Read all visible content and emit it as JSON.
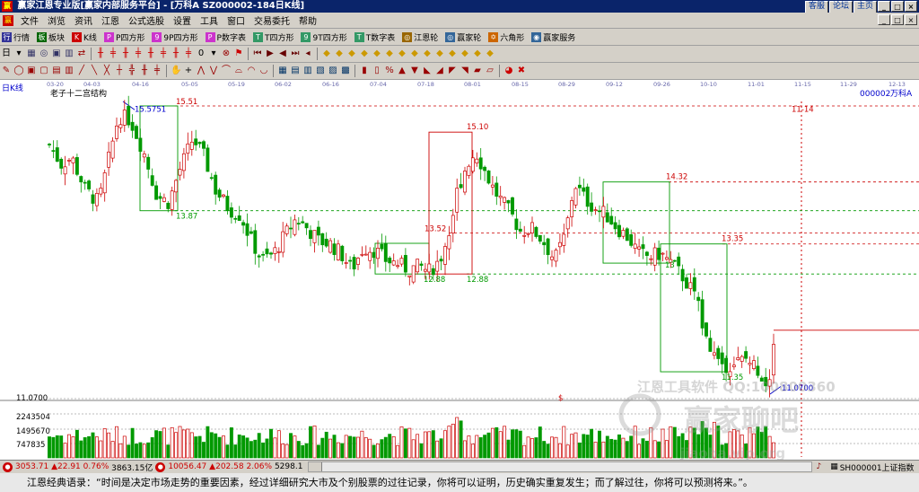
{
  "window": {
    "title": "赢家江恩专业版[赢家内部服务平台] - [万科A  SZ000002-184日K线]",
    "logo_text": "赢",
    "links": [
      "客服",
      "论坛",
      "主页"
    ],
    "controls": [
      "_",
      "□",
      "×"
    ]
  },
  "menu": {
    "items": [
      "文件",
      "浏览",
      "资讯",
      "江恩",
      "公式选股",
      "设置",
      "工具",
      "窗口",
      "交易委托",
      "帮助"
    ]
  },
  "toolbar1": {
    "items": [
      {
        "icon": "行",
        "label": "行情",
        "color": "#333399"
      },
      {
        "icon": "板",
        "label": "板块",
        "color": "#006600"
      },
      {
        "icon": "K",
        "label": "K线",
        "color": "#cc0000"
      },
      {
        "icon": "P",
        "label": "P四方形",
        "color": "#cc33cc"
      },
      {
        "icon": "9",
        "label": "9P四方形",
        "color": "#cc33cc"
      },
      {
        "icon": "P",
        "label": "P数字表",
        "color": "#cc33cc"
      },
      {
        "icon": "T",
        "label": "T四方形",
        "color": "#339966"
      },
      {
        "icon": "9",
        "label": "9T四方形",
        "color": "#339966"
      },
      {
        "icon": "T",
        "label": "T数字表",
        "color": "#339966"
      },
      {
        "icon": "◎",
        "label": "江恩轮",
        "color": "#996600"
      },
      {
        "icon": "◎",
        "label": "赢家轮",
        "color": "#336699"
      },
      {
        "icon": "✡",
        "label": "六角形",
        "color": "#cc6600"
      },
      {
        "icon": "◉",
        "label": "赢家服务",
        "color": "#336699"
      }
    ]
  },
  "chart_header": {
    "period_label": "日K线",
    "indicator_title": "老子十二宫结构",
    "stock_code": "000002",
    "stock_name": "万科A"
  },
  "chart_data": {
    "type": "candlestick",
    "x_tick_labels": [
      "03-20",
      "04-03",
      "04-16",
      "05-05",
      "05-19",
      "06-02",
      "06-16",
      "07-04",
      "07-18",
      "08-01",
      "08-15",
      "08-29",
      "09-12",
      "09-26",
      "10-10",
      "11-01",
      "11-15",
      "11-29",
      "12-13"
    ],
    "price_labels": {
      "y_axis_low": "11.0700",
      "start_low": "15.5751",
      "high_1": "15.51",
      "low_1": "13.87",
      "high_2": "15.10",
      "mid_2": "13.52",
      "low_2a": "12.88",
      "low_2b": "12.88",
      "high_3": "14.32",
      "high_4": "13.35",
      "mid_4": "13",
      "low_4": "11.35",
      "last_low": "11.0700",
      "date_mark": "11-14"
    },
    "volume_axis_labels": [
      "2243504",
      "1495670",
      "747835"
    ],
    "volume_unit": "$",
    "candles_count": 184,
    "price_range": [
      11.07,
      15.58
    ],
    "colors": {
      "up": "#cc0000",
      "down": "#009900",
      "grid": "#c0c0c0",
      "red_dash": "#cc0000",
      "green_dash": "#009900",
      "blue": "#0000cc"
    }
  },
  "watermark": {
    "line1": "江恩工具软件 QQ:100800360",
    "line2": "赢家聊吧",
    "line3": "jiaoba.vip.org"
  },
  "status": {
    "index1_name": "3053.71",
    "index1_change": "▲22.91",
    "index1_pct": "0.76%",
    "index1_amount": "3863.15亿",
    "index2_name": "10056.47",
    "index2_change": "▲202.58",
    "index2_pct": "2.06%",
    "index2_amount": "5298.1",
    "right_label": "SH000001上证指数"
  },
  "quote": {
    "text": "江恩经典语录：“时间是决定市场走势的重要因素，经过详细研究大市及个别股票的过往记录，你将可以证明，历史确实重复发生；而了解过往，你将可以预测将来。”。"
  }
}
